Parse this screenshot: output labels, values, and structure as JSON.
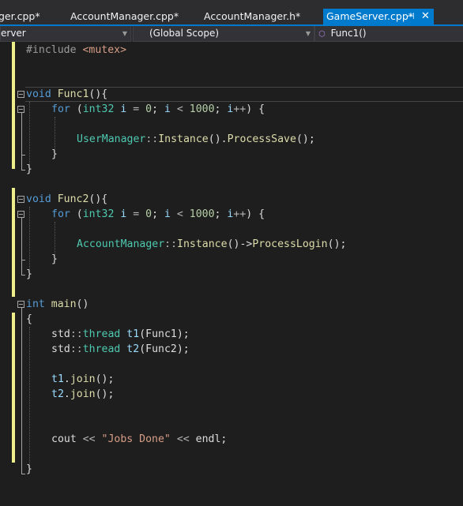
{
  "tabs": [
    {
      "label": "ger.cpp*"
    },
    {
      "label": "AccountManager.cpp*"
    },
    {
      "label": "AccountManager.h*"
    },
    {
      "label": "GameServer.cpp*",
      "active": true
    }
  ],
  "nav": {
    "project": "erver",
    "scope": "(Global Scope)",
    "function": "Func1()"
  },
  "code": {
    "l1": {
      "directive": "#include",
      "header": "<mutex>"
    },
    "l4": {
      "type": "void",
      "name": "Func1",
      "punct": "(){"
    },
    "l5": {
      "kw": "for",
      "open": " (",
      "type": "int32",
      "var": " i",
      "eq": " = ",
      "zero": "0",
      "semi": "; ",
      "var2": "i",
      "lt": " < ",
      "limit": "1000",
      "semi2": "; ",
      "var3": "i",
      "inc": "++",
      "close": ") {"
    },
    "l7": {
      "cls": "UserManager",
      "scope": "::",
      "fn1": "Instance",
      "mid": "().",
      "fn2": "ProcessSave",
      "end": "();"
    },
    "l8": {
      "text": "}"
    },
    "l9": {
      "text": "}"
    },
    "l11": {
      "type": "void",
      "name": "Func2",
      "punct": "(){"
    },
    "l12": {
      "kw": "for",
      "open": " (",
      "type": "int32",
      "var": " i",
      "eq": " = ",
      "zero": "0",
      "semi": "; ",
      "var2": "i",
      "lt": " < ",
      "limit": "1000",
      "semi2": "; ",
      "var3": "i",
      "inc": "++",
      "close": ") {"
    },
    "l14": {
      "cls": "AccountManager",
      "scope": "::",
      "fn1": "Instance",
      "mid": "()->",
      "fn2": "ProcessLogin",
      "end": "();"
    },
    "l15": {
      "text": "}"
    },
    "l16": {
      "text": "}"
    },
    "l18": {
      "type": "int",
      "name": "main",
      "punct": "()"
    },
    "l19": {
      "text": "{"
    },
    "l20": {
      "ns": "std",
      "scope": "::",
      "cls": "thread",
      "var": " t1",
      "open": "(",
      "arg": "Func1",
      "close": ");"
    },
    "l21": {
      "ns": "std",
      "scope": "::",
      "cls": "thread",
      "var": " t2",
      "open": "(",
      "arg": "Func2",
      "close": ");"
    },
    "l23": {
      "var": "t1",
      "dot": ".",
      "fn": "join",
      "end": "();"
    },
    "l24": {
      "var": "t2",
      "dot": ".",
      "fn": "join",
      "end": "();"
    },
    "l27": {
      "a": "cout",
      "op1": " << ",
      "str": "\"Jobs Done\"",
      "op2": " << ",
      "b": "endl",
      "end": ";"
    },
    "l29": {
      "text": "}"
    }
  },
  "colors": {
    "background": "#1e1e1e",
    "keyword": "#569cd6",
    "type": "#4ec9b0",
    "function": "#dcdcaa",
    "string": "#d69d85",
    "number": "#b5cea8",
    "accent": "#007acc",
    "change_marker": "#efef8a"
  }
}
